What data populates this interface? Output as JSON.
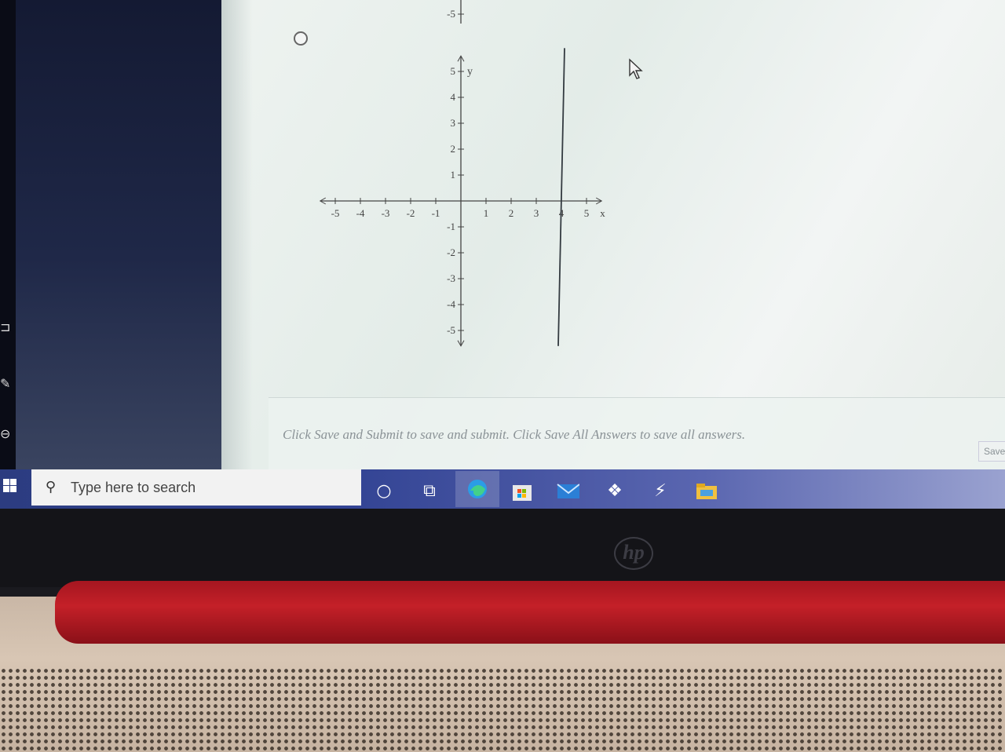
{
  "graph": {
    "top_partial_tick": "-5",
    "y_axis_label": "y",
    "x_axis_label": "x",
    "x_ticks": [
      "-5",
      "-4",
      "-3",
      "-2",
      "-1",
      "1",
      "2",
      "3",
      "4",
      "5"
    ],
    "y_ticks": [
      "5",
      "4",
      "3",
      "2",
      "1",
      "-1",
      "-2",
      "-3",
      "-4",
      "-5"
    ],
    "plotted_line": {
      "type": "vertical",
      "x": 4,
      "y_range": [
        -6,
        6
      ]
    },
    "line_color": "#333a40"
  },
  "footer": {
    "instruction": "Click Save and Submit to save and submit. Click Save All Answers to save all answers.",
    "save_button_label": "Save"
  },
  "taskbar": {
    "search_placeholder": "Type here to search",
    "icons": [
      "windows-start-icon",
      "search-icon",
      "cortana-icon",
      "task-view-icon",
      "edge-icon",
      "store-icon",
      "mail-icon",
      "dropbox-icon",
      "app-icon",
      "file-explorer-icon"
    ]
  },
  "device": {
    "brand_logo": "hp"
  },
  "colors": {
    "accent_red": "#c42028",
    "taskbar_blue": "#334494"
  }
}
